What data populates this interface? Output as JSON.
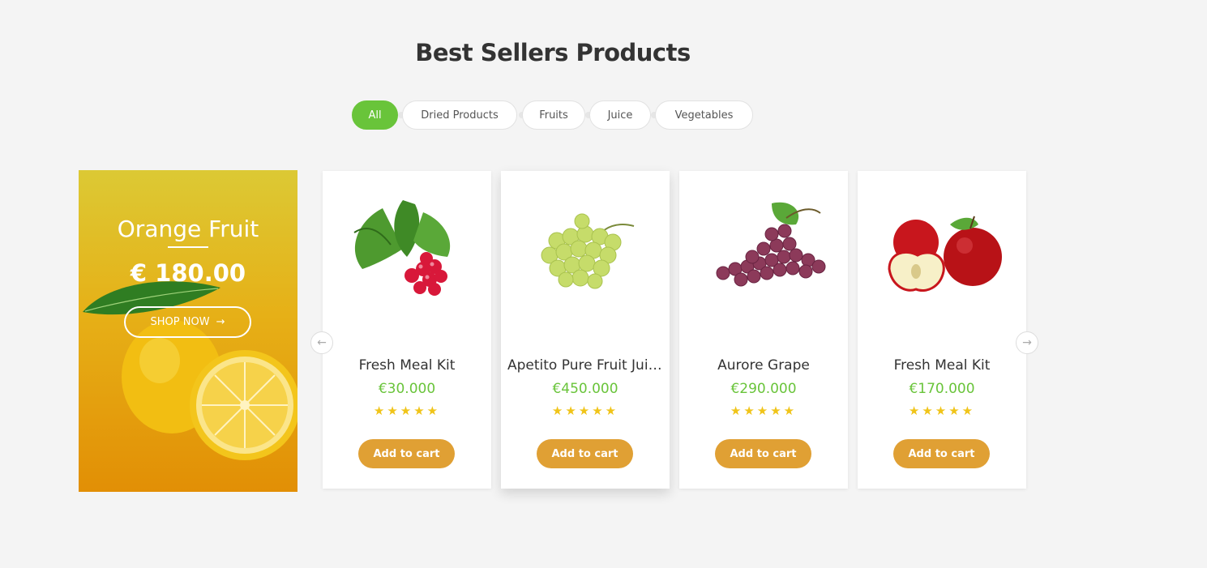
{
  "section": {
    "title": "Best Sellers Products"
  },
  "tabs": [
    {
      "label": "All",
      "active": true
    },
    {
      "label": "Dried Products",
      "active": false
    },
    {
      "label": "Fruits",
      "active": false
    },
    {
      "label": "Juice",
      "active": false
    },
    {
      "label": "Vegetables",
      "active": false
    }
  ],
  "banner": {
    "title": "Orange Fruit",
    "price": "€ 180.00",
    "button_label": "SHOP NOW",
    "button_icon": "arrow-right-icon"
  },
  "carousel": {
    "prev_icon": "arrow-left-icon",
    "next_icon": "arrow-right-icon"
  },
  "products": [
    {
      "name": "Fresh Meal Kit",
      "price": "€30.000",
      "stars": "★★★★★",
      "rating": 5,
      "button": "Add to cart",
      "image": "radish"
    },
    {
      "name": "Apetito Pure Fruit Juice",
      "price": "€450.000",
      "stars": "★★★★★",
      "rating": 5,
      "button": "Add to cart",
      "image": "green-grapes"
    },
    {
      "name": "Aurore Grape",
      "price": "€290.000",
      "stars": "★★★★★",
      "rating": 5,
      "button": "Add to cart",
      "image": "red-grapes"
    },
    {
      "name": "Fresh Meal Kit",
      "price": "€170.000",
      "stars": "★★★★★",
      "rating": 5,
      "button": "Add to cart",
      "image": "apples"
    }
  ],
  "colors": {
    "accent_green": "#69c43a",
    "cart_orange": "#e0a034",
    "star_yellow": "#f0c419"
  }
}
